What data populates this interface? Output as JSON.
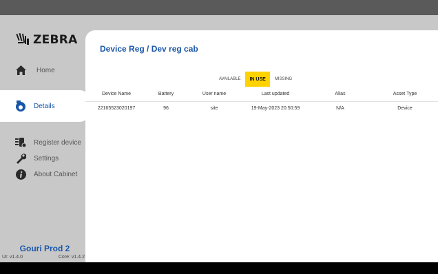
{
  "brand": {
    "logo_text": "ZEBRA"
  },
  "nav": {
    "home": "Home",
    "details": "Details",
    "register": "Register device",
    "settings": "Settings",
    "about": "About Cabinet"
  },
  "footer": {
    "cabinet_name": "Gouri Prod 2",
    "ui_version": "UI: v1.4.0",
    "core_version": "Core: v1.4.2"
  },
  "page": {
    "title": "Device Reg / Dev reg cab"
  },
  "tabs": {
    "available": "AVAILABLE",
    "in_use": "IN USE",
    "missing": "MISSING",
    "active": "IN USE"
  },
  "table": {
    "headers": [
      "Device Name",
      "Battery",
      "User name",
      "Last updated",
      "Alias",
      "Asset Type"
    ],
    "rows": [
      [
        "22165523020197",
        "96",
        "site",
        "19-May-2023 20:50:59",
        "N/A",
        "Device"
      ]
    ]
  },
  "colors": {
    "accent": "#1a56a8",
    "active_tab": "#ffd200",
    "topbar": "#5a5a5a"
  }
}
